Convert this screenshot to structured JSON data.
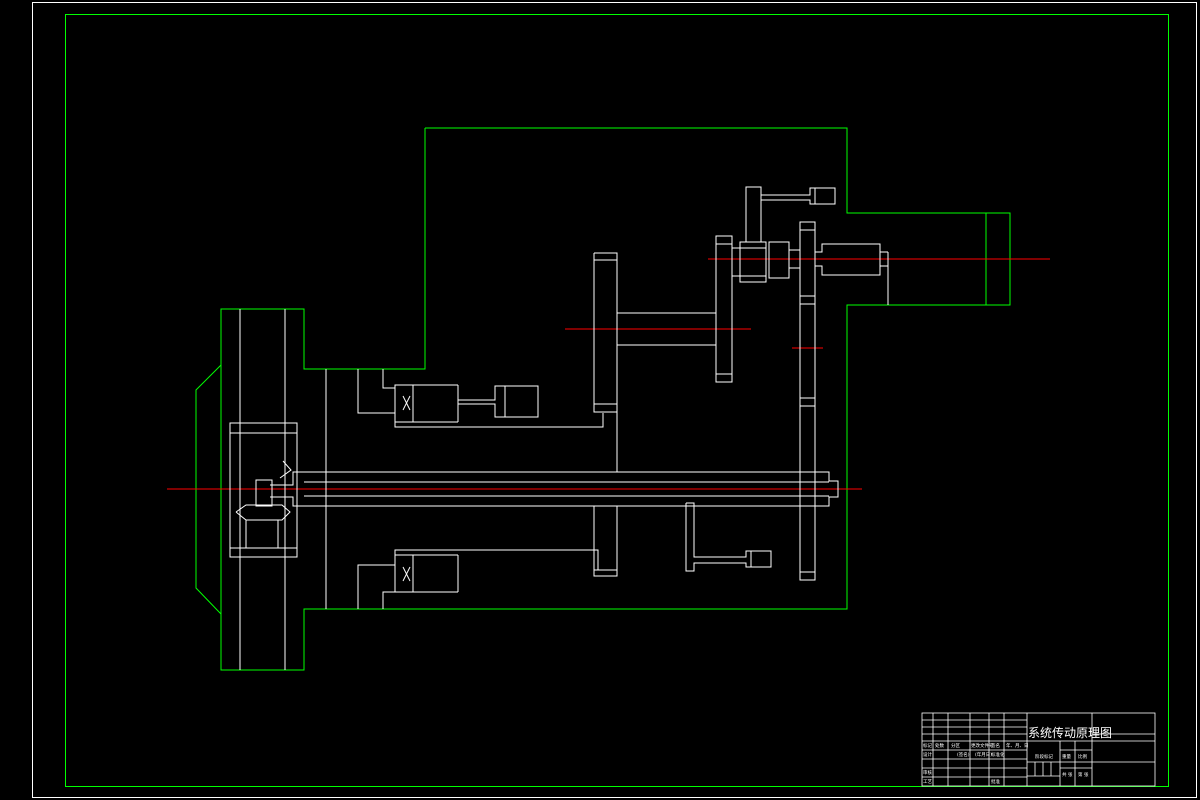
{
  "drawing": {
    "title": "系统传动原理图",
    "background": "#000000",
    "colors": {
      "outline": "#ffffff",
      "frame": "#00ff00",
      "centerline": "#ff0000"
    }
  },
  "title_block": {
    "cells_row1": [
      "标记",
      "处数",
      "分区",
      "更改文件号",
      "签名",
      "年、月、日"
    ],
    "cells_row2": [
      "设计",
      "",
      "(签名)",
      "(年月日)",
      "标准化",
      "",
      ""
    ],
    "cells_row3": [
      "审核",
      ""
    ],
    "cells_row4": [
      "工艺",
      "",
      "",
      "",
      "批准"
    ],
    "right_labels": [
      "阶段标记",
      "重量",
      "比例",
      "共 张",
      "第 张"
    ]
  }
}
